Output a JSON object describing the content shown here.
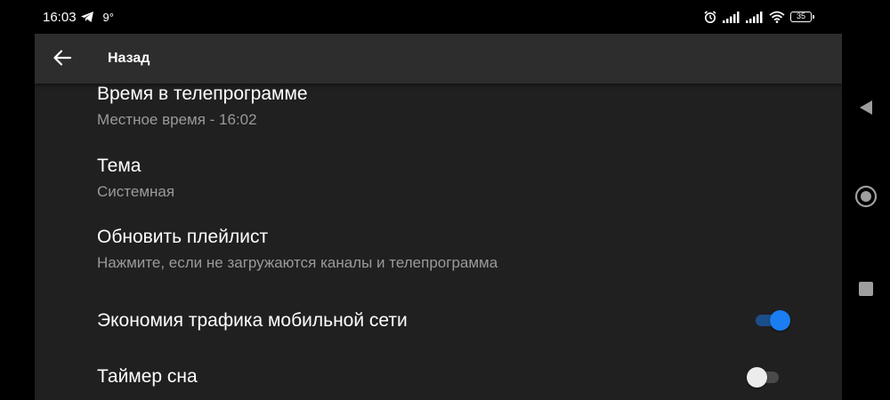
{
  "status_bar": {
    "time": "16:03",
    "temperature": "9°",
    "battery": "35",
    "icons": [
      "telegram-icon",
      "alarm-icon",
      "signal-icon",
      "signal-icon",
      "wifi-icon",
      "battery-icon"
    ]
  },
  "toolbar": {
    "back_icon": "arrow-left-icon",
    "title": "Назад"
  },
  "settings": [
    {
      "title": "Время в телепрограмме",
      "subtitle": "Местное время - 16:02"
    },
    {
      "title": "Тема",
      "subtitle": "Системная"
    },
    {
      "title": "Обновить плейлист",
      "subtitle": "Нажмите, если не загружаются каналы и телепрограмма"
    },
    {
      "title": "Экономия трафика мобильной сети",
      "switch_on": true
    },
    {
      "title": "Таймер сна",
      "switch_on": false
    }
  ],
  "nav_bar": {
    "icons": [
      "back-triangle-icon",
      "home-circle-icon",
      "recents-square-icon"
    ]
  },
  "colors": {
    "background": "#202020",
    "toolbar": "#2d2d2d",
    "accent": "#1a7df2",
    "subtitle": "#9a9a9a"
  }
}
